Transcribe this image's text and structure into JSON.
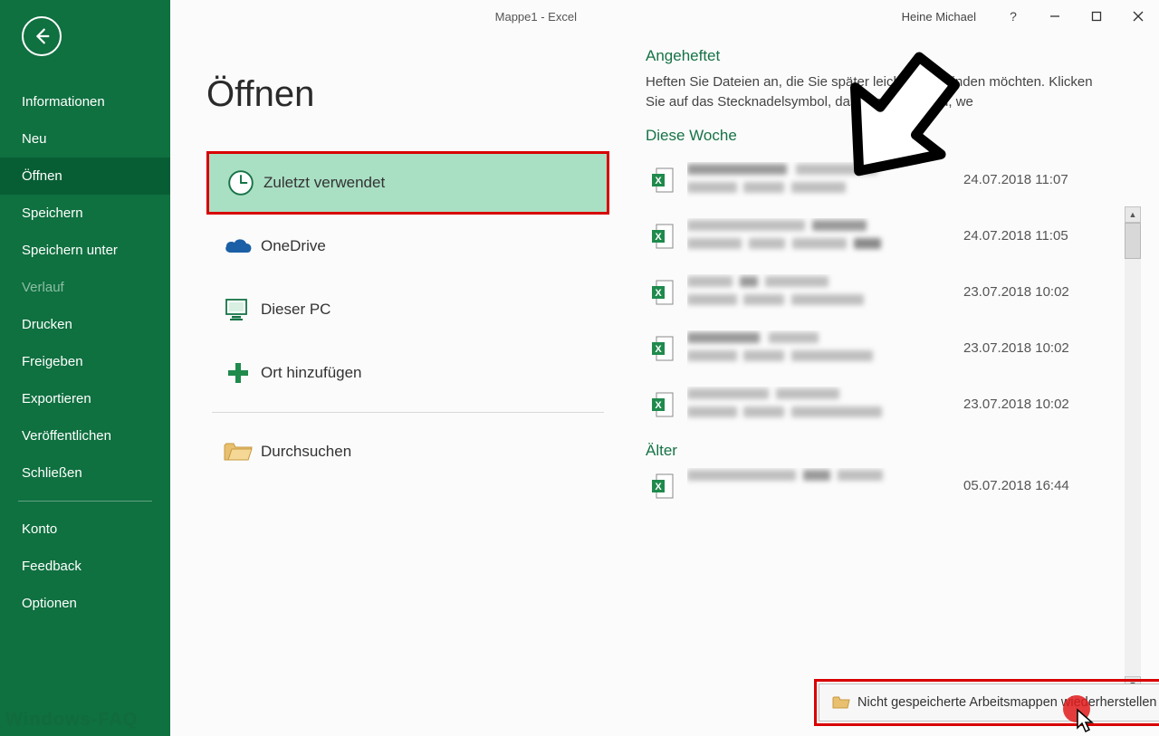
{
  "app_title": "Mappe1  -  Excel",
  "user_name": "Heine Michael",
  "help_symbol": "?",
  "sidebar": {
    "items": [
      {
        "label": "Informationen",
        "state": ""
      },
      {
        "label": "Neu",
        "state": ""
      },
      {
        "label": "Öffnen",
        "state": "selected"
      },
      {
        "label": "Speichern",
        "state": ""
      },
      {
        "label": "Speichern unter",
        "state": ""
      },
      {
        "label": "Verlauf",
        "state": "disabled"
      },
      {
        "label": "Drucken",
        "state": ""
      },
      {
        "label": "Freigeben",
        "state": ""
      },
      {
        "label": "Exportieren",
        "state": ""
      },
      {
        "label": "Veröffentlichen",
        "state": ""
      },
      {
        "label": "Schließen",
        "state": ""
      }
    ],
    "footer": [
      {
        "label": "Konto"
      },
      {
        "label": "Feedback"
      },
      {
        "label": "Optionen"
      }
    ]
  },
  "page_heading": "Öffnen",
  "locations": {
    "recent": "Zuletzt verwendet",
    "onedrive": "OneDrive",
    "thispc": "Dieser PC",
    "addplace": "Ort hinzufügen",
    "browse": "Durchsuchen"
  },
  "panel": {
    "pinned_head": "Angeheftet",
    "pinned_help": "Heften Sie Dateien an, die Sie später leicht wiederfinden möchten. Klicken Sie auf das Stecknadelsymbol, das angezeigt wird, we",
    "week_head": "Diese Woche",
    "older_head": "Älter",
    "files_week": [
      {
        "date": "24.07.2018 11:07"
      },
      {
        "date": "24.07.2018 11:05"
      },
      {
        "date": "23.07.2018 10:02"
      },
      {
        "date": "23.07.2018 10:02"
      },
      {
        "date": "23.07.2018 10:02"
      }
    ],
    "files_older": [
      {
        "date": "05.07.2018 16:44"
      }
    ]
  },
  "recover_label": "Nicht gespeicherte Arbeitsmappen wiederherstellen",
  "watermark": "Windows-FAQ"
}
